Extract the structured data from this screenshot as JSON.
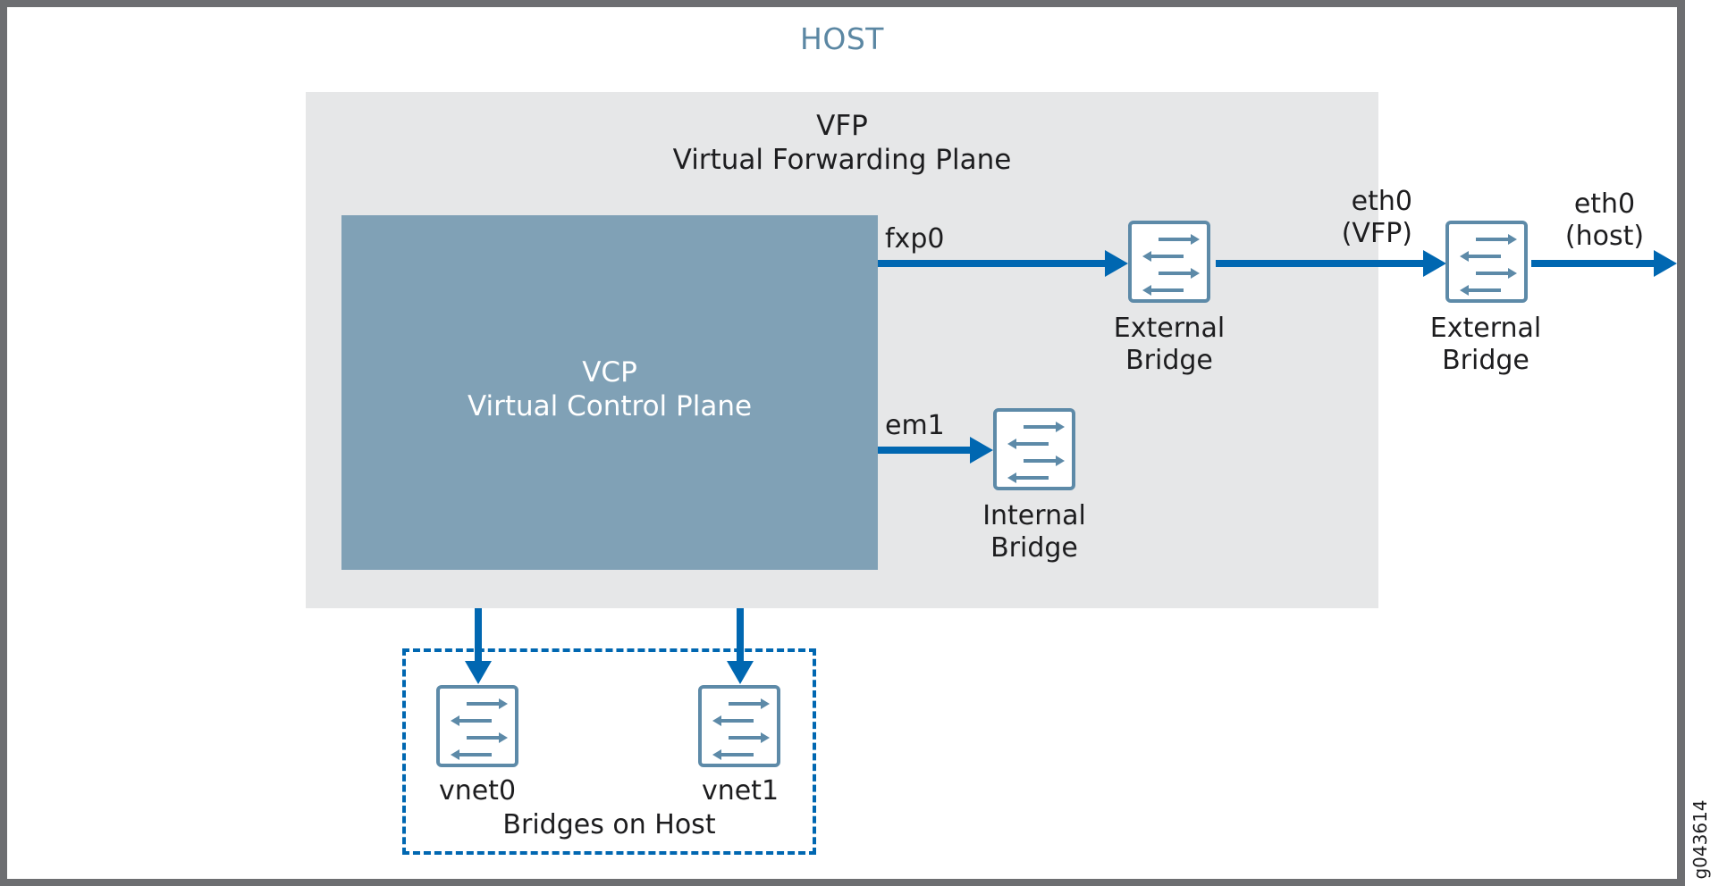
{
  "diagram": {
    "host_label": "HOST",
    "vfp": {
      "abbr": "VFP",
      "name": "Virtual Forwarding Plane"
    },
    "vcp": {
      "abbr": "VCP",
      "name": "Virtual Control Plane"
    },
    "interfaces": {
      "fxp0": "fxp0",
      "em1": "em1",
      "eth0_vfp_line1": "eth0",
      "eth0_vfp_line2": "(VFP)",
      "eth0_host_line1": "eth0",
      "eth0_host_line2": "(host)"
    },
    "bridges": [
      {
        "id": "external-bridge-vfp",
        "line1": "External",
        "line2": "Bridge"
      },
      {
        "id": "external-bridge-host",
        "line1": "External",
        "line2": "Bridge"
      },
      {
        "id": "internal-bridge",
        "line1": "Internal",
        "line2": "Bridge"
      },
      {
        "id": "vnet0",
        "line1": "vnet0"
      },
      {
        "id": "vnet1",
        "line1": "vnet1"
      }
    ],
    "host_bridges_group_label": "Bridges on Host",
    "figure_id": "g043614",
    "colors": {
      "frame": "#6d6e71",
      "host_title": "#5b87a3",
      "vfp_fill": "#e6e7e8",
      "vcp_fill": "#80a1b6",
      "link": "#0067b1",
      "bridge_stroke": "#5d8aa8"
    },
    "connections": [
      {
        "from": "VCP",
        "to": "External Bridge (VFP)",
        "label": "fxp0"
      },
      {
        "from": "External Bridge (VFP)",
        "to": "External Bridge (host)",
        "label": "eth0 (VFP)"
      },
      {
        "from": "External Bridge (host)",
        "to": "outside",
        "label": "eth0 (host)"
      },
      {
        "from": "VCP",
        "to": "Internal Bridge",
        "label": "em1"
      },
      {
        "from": "VFP",
        "to": "vnet0",
        "label": ""
      },
      {
        "from": "VFP",
        "to": "vnet1",
        "label": ""
      }
    ]
  }
}
